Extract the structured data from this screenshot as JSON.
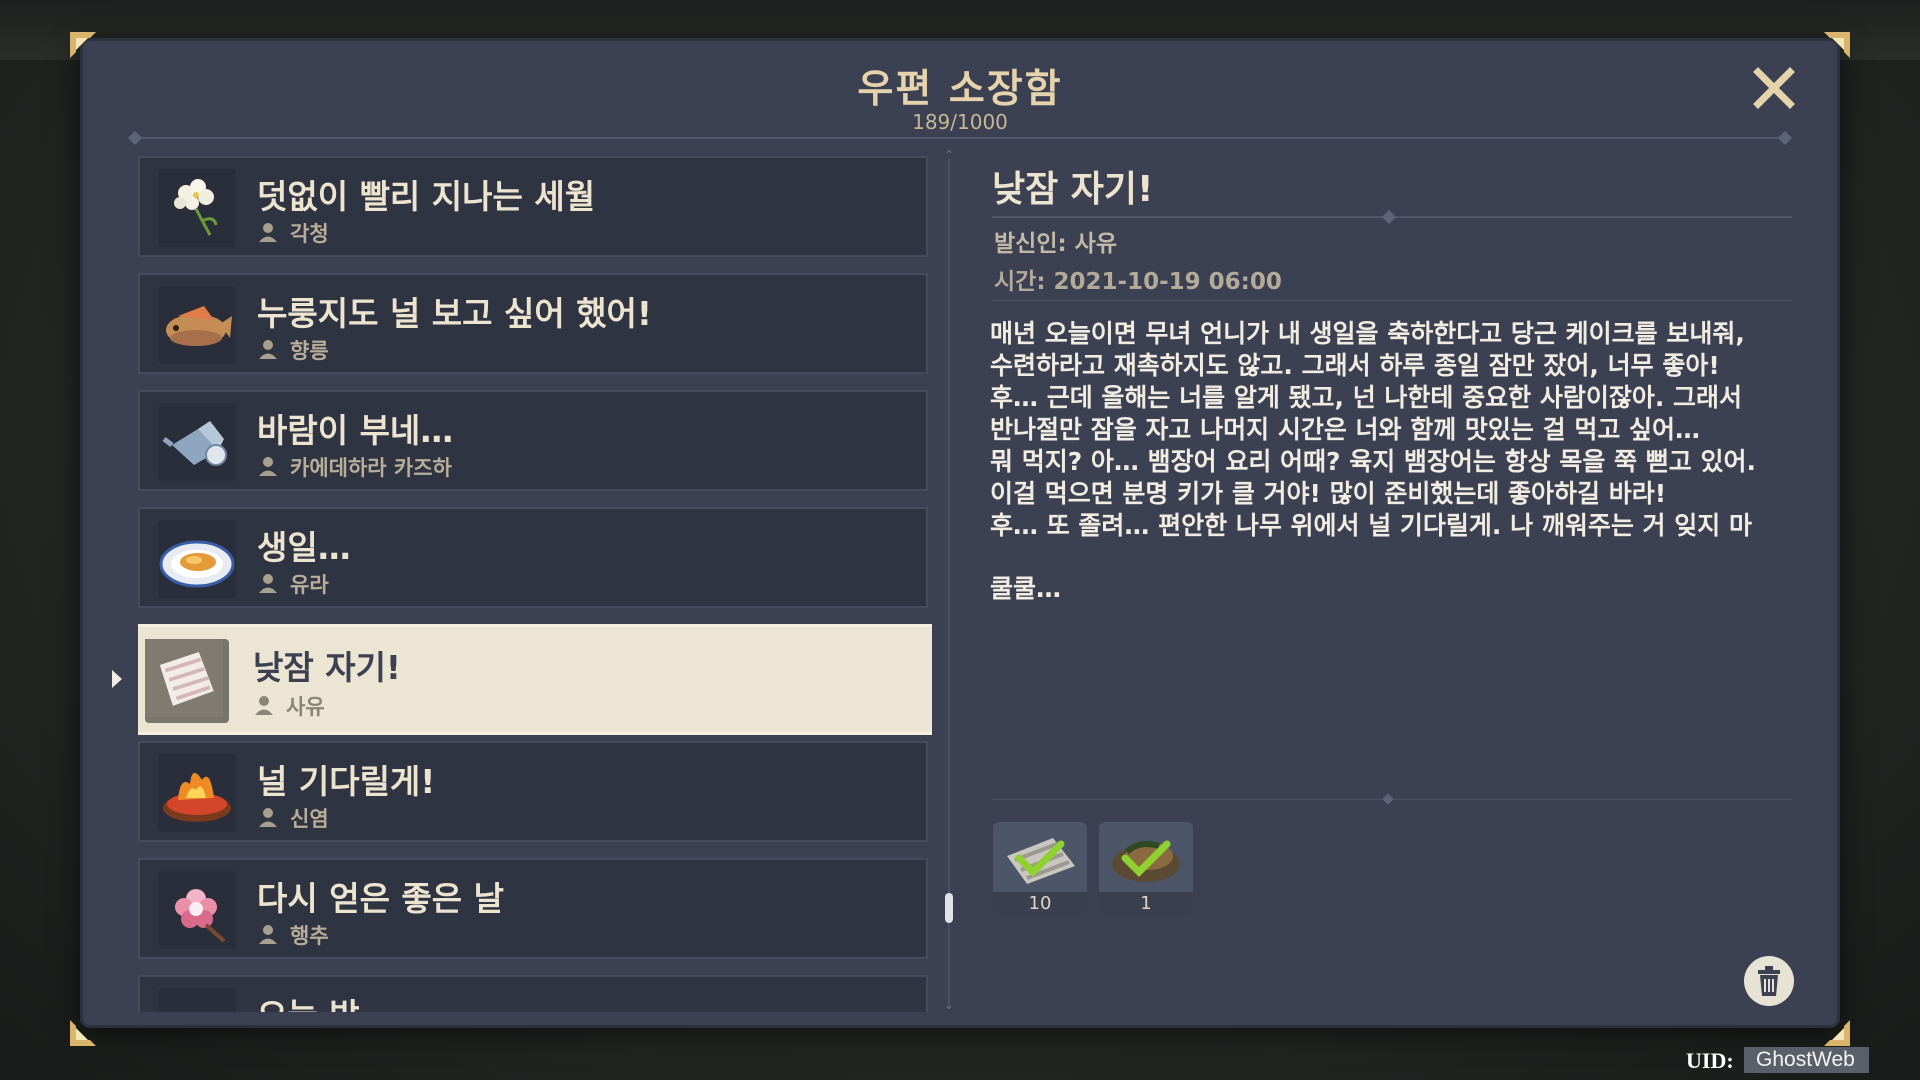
{
  "mailbox": {
    "title": "우편 소장함",
    "count": "189/1000"
  },
  "colors": {
    "panel_bg": "#3b4152",
    "item_bg": "#2f3442",
    "selected_bg": "#ede5d3",
    "title_gold": "#e6d3ac",
    "check_green": "#8fd12f"
  },
  "mails": [
    {
      "subject": "덧없이 빨리 지나는 세월",
      "sender": "각청",
      "icon": "flower-icon"
    },
    {
      "subject": "누룽지도 널 보고 싶어 했어!",
      "sender": "향릉",
      "icon": "fish-plush-icon"
    },
    {
      "subject": "바람이 부네…",
      "sender": "카에데하라 카즈하",
      "icon": "teapot-icon"
    },
    {
      "subject": "생일…",
      "sender": "유라",
      "icon": "food-plate-icon"
    },
    {
      "subject": "낮잠 자기!",
      "sender": "사유",
      "icon": "eel-fillet-icon",
      "selected": true
    },
    {
      "subject": "널 기다릴게!",
      "sender": "신염",
      "icon": "fire-dish-icon"
    },
    {
      "subject": "다시 얻은 좋은 날",
      "sender": "행추",
      "icon": "flower-brooch-icon"
    },
    {
      "subject": "오늘 밤…",
      "sender": "",
      "icon": "misc-icon"
    }
  ],
  "detail": {
    "title": "낮잠 자기!",
    "sender": "발신인: 사유",
    "time": "시간: 2021-10-19 06:00",
    "body": [
      "매년 오늘이면 무녀 언니가 내 생일을 축하한다고 당근 케이크를 보내줘,",
      "수련하라고 재촉하지도 않고. 그래서 하루 종일 잠만 잤어, 너무 좋아!",
      "후… 근데 올해는 너를 알게 됐고, 넌 나한테 중요한 사람이잖아. 그래서",
      "반나절만 잠을 자고 나머지 시간은 너와 함께 맛있는 걸 먹고 싶어…",
      "뭐 먹지? 아… 뱀장어 요리 어때? 육지 뱀장어는 항상 목을 쭉 뻗고 있어.",
      "이걸 먹으면 분명 키가 클 거야! 많이 준비했는데 좋아하길 바라!",
      "후… 또 졸려… 편안한 나무 위에서 널 기다릴게. 나 깨워주는 거 잊지 마"
    ],
    "closing": "쿨쿨…",
    "attachments": [
      {
        "item": "eel-meat-icon",
        "count": "10",
        "claimed": true
      },
      {
        "item": "dish-icon",
        "count": "1",
        "claimed": true
      }
    ]
  },
  "icons": {
    "close": "close-icon",
    "delete": "trash-icon",
    "sender": "person-icon"
  },
  "footer": {
    "uid_label": "UID:",
    "uid_value": "GhostWeb"
  }
}
